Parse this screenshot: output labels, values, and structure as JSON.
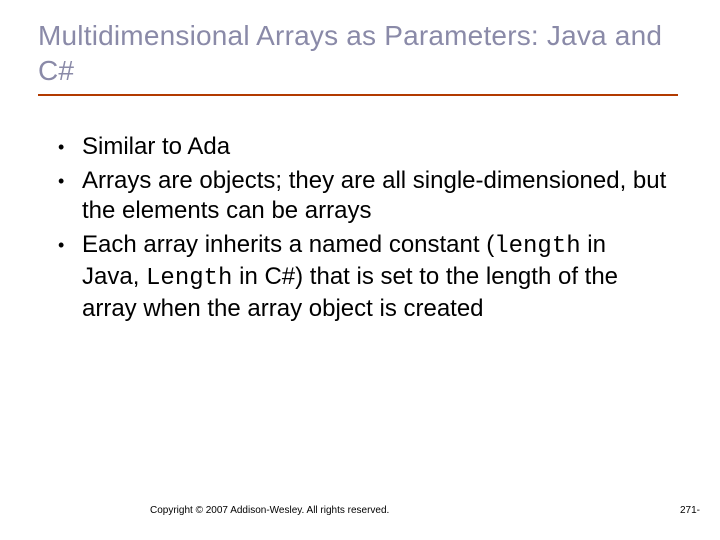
{
  "title": "Multidimensional Arrays as Parameters: Java and C#",
  "bullets": {
    "b1": "Similar to Ada",
    "b2": "Arrays are objects; they are all single-dimensioned, but the elements can be arrays",
    "b3_pre": "Each array inherits a named constant (",
    "b3_code1": "length",
    "b3_mid1": " in Java, ",
    "b3_code2": "Length",
    "b3_mid2": " in C#) that is set to the length of the array when the array object is created"
  },
  "footer": {
    "copyright": "Copyright © 2007 Addison-Wesley. All rights reserved.",
    "page": "271-"
  }
}
